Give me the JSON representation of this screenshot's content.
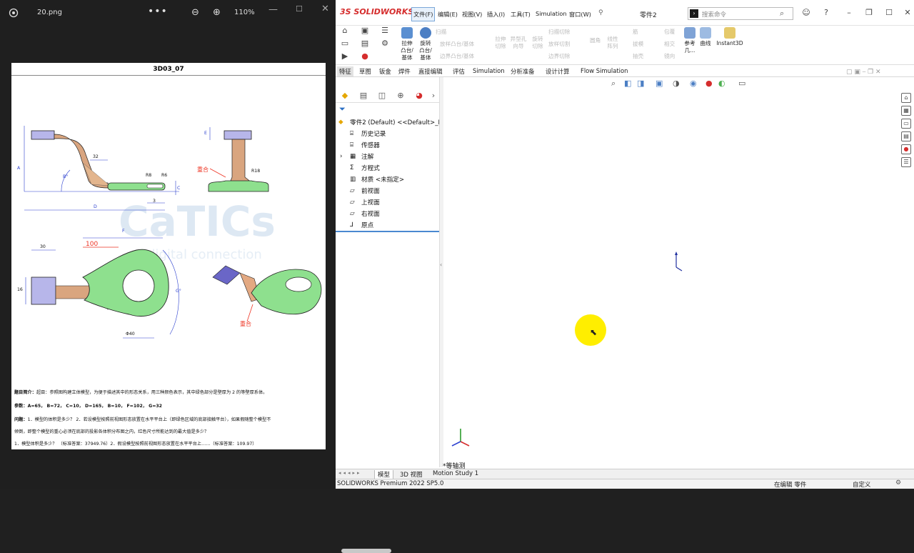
{
  "photos": {
    "filename": "20.png",
    "zoom": "110%",
    "more_glyph": "•••",
    "zoom_out_glyph": "⊖",
    "zoom_in_glyph": "⊕",
    "min_glyph": "—",
    "max_glyph": "☐",
    "close_glyph": "✕"
  },
  "drawing": {
    "title": "3D03_07",
    "watermark": "CaTICs",
    "watermark_sub": "digital connection",
    "labels": {
      "A": "A",
      "B": "B°",
      "C": "C",
      "D": "D",
      "E": "E",
      "F": "F",
      "G": "G°",
      "d30": "30",
      "d100": "100",
      "d32": "32",
      "d15": "15",
      "d16": "16",
      "d40": "Φ40",
      "r16": "R16",
      "r18": "R18",
      "r8": "R8",
      "r6": "R6",
      "overlap1": "重合",
      "overlap2": "重合",
      "d4": "4",
      "d3": "3",
      "d5": "5",
      "e": "8"
    },
    "intro_label": "题目简介：",
    "intro": "超目：参照图构建立体模型，为便于描述其中的形态关系，用三种颜色表示，其中绿色部分是壁厚为 2 的等壁厚系体。",
    "params_label": "参数：",
    "params": "A=65，  B=72，  C=10，  D=165，  B=10，  F=102，  G=32",
    "question_label": "问题：",
    "question_1": "1．模型的体积是多少？ 2．若设模型按照前视图形态放置在水平平台上（即绿色区域的底部接触平台），如果假随整个模型不",
    "question_2": "倾倒，即整个模型的重心必须在底部的投影各体积分布图之内，红色尺寸所能达到的最大值是多少？",
    "answer_1": "1．模型体积是多少？          （标准答案：37949.76）2．假设模型按照前视图形态放置在水平平台上……（标准答案：109.97）"
  },
  "solidworks": {
    "logo": "3S SOLIDWORKS",
    "menus": [
      "文件(F)",
      "编辑(E)",
      "视图(V)",
      "插入(I)",
      "工具(T)",
      "Simulation",
      "窗口(W)"
    ],
    "pin_glyph": "⚲",
    "doc_title": "零件2",
    "search_placeholder": "搜索命令",
    "ribbon": {
      "extrude": "拉伸\n凸台/\n基体",
      "revolve": "旋转\n凸台/\n基体",
      "sweep": "扫描",
      "loft": "放样凸台/基体",
      "boundary": "边界凸台/基体",
      "extrude_cut": "拉伸\n切除",
      "hole": "异型孔\n向导",
      "revolve_cut": "旋转\n切除",
      "sweep_cut": "扫描切除",
      "loft_cut": "放样切割",
      "boundary_cut": "边界切除",
      "fillet": "圆角",
      "pattern": "线性\n阵列",
      "rib": "筋",
      "draft": "拔模",
      "shell": "抽壳",
      "wrap": "包覆",
      "intersect": "相交",
      "mirror": "镜向",
      "ref_geom": "参考\n几...",
      "curves": "曲线",
      "instant3d": "Instant3D"
    },
    "command_tabs": [
      "特征",
      "草图",
      "钣金",
      "焊件",
      "直接编辑",
      "评估",
      "Simulation",
      "分析准备",
      "设计计算",
      "Flow Simulation"
    ],
    "active_tab": "特征",
    "tree": {
      "root": "零件2 (Default) <<Default>_F",
      "items": [
        "历史记录",
        "传感器",
        "注解",
        "方程式",
        "材质 <未指定>",
        "前视面",
        "上视面",
        "右视面",
        "原点"
      ]
    },
    "view_label": "*等轴测",
    "bottom_tabs": [
      "模型",
      "3D 视图",
      "Motion Study 1"
    ],
    "bottom_nav": "◂◂◂▸▸",
    "status_left": "SOLIDWORKS Premium 2022 SP5.0",
    "status_mid": "在编辑 零件",
    "status_right": "自定义",
    "colors": {
      "accent": "#d52d2d",
      "selection": "#4a88d0",
      "highlight": "#ffee00"
    }
  }
}
